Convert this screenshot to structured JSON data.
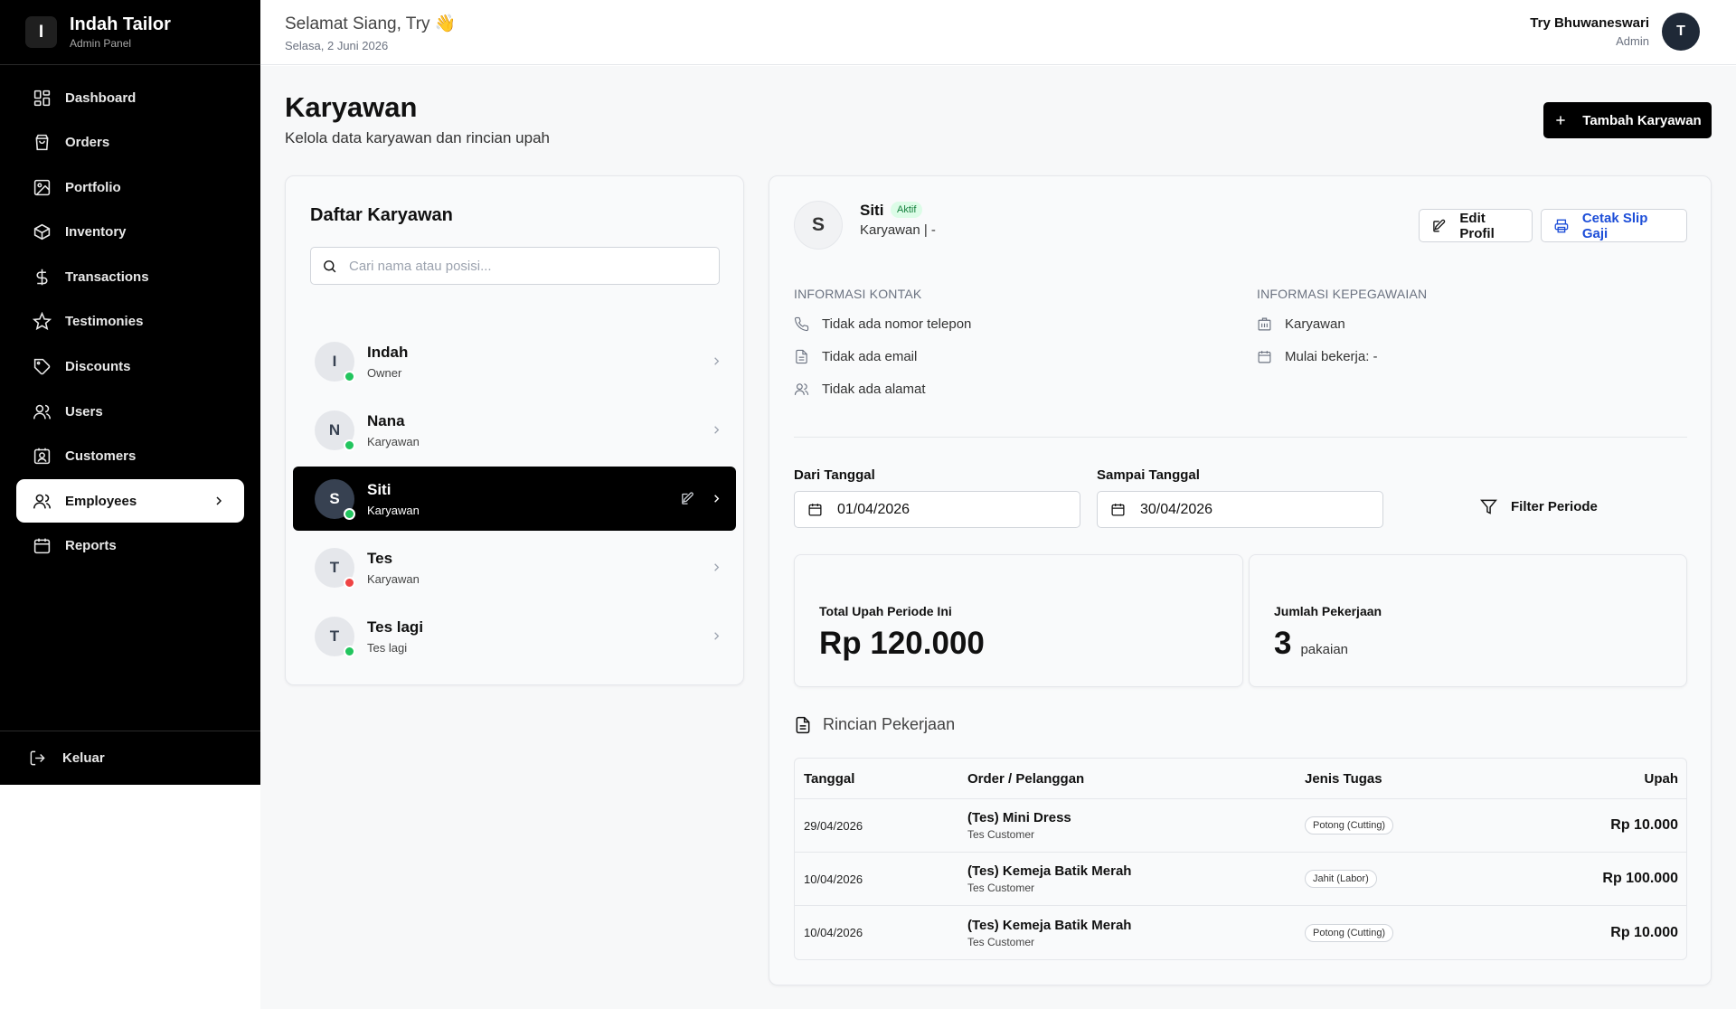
{
  "brand": {
    "initial": "I",
    "name": "Indah Tailor",
    "sub": "Admin Panel"
  },
  "nav": {
    "items": [
      {
        "label": "Dashboard",
        "icon": "dashboard-icon"
      },
      {
        "label": "Orders",
        "icon": "shopping-bag-icon"
      },
      {
        "label": "Portfolio",
        "icon": "image-icon"
      },
      {
        "label": "Inventory",
        "icon": "box-icon"
      },
      {
        "label": "Transactions",
        "icon": "dollar-icon"
      },
      {
        "label": "Testimonies",
        "icon": "star-icon"
      },
      {
        "label": "Discounts",
        "icon": "tag-icon"
      },
      {
        "label": "Users",
        "icon": "users-icon"
      },
      {
        "label": "Customers",
        "icon": "contact-icon"
      },
      {
        "label": "Employees",
        "icon": "users-icon"
      },
      {
        "label": "Reports",
        "icon": "calendar-icon"
      }
    ],
    "active": "Employees",
    "logout": "Keluar"
  },
  "topbar": {
    "greeting": "Selamat Siang, Try 👋",
    "date": "Selasa, 2 Juni 2026",
    "user_name": "Try Bhuwaneswari",
    "user_role": "Admin",
    "user_initial": "T"
  },
  "page": {
    "title": "Karyawan",
    "subtitle": "Kelola data karyawan dan rincian upah",
    "add_button": "Tambah Karyawan"
  },
  "list": {
    "title": "Daftar Karyawan",
    "search_placeholder": "Cari nama atau posisi...",
    "employees": [
      {
        "initial": "I",
        "name": "Indah",
        "role": "Owner",
        "status": "active"
      },
      {
        "initial": "N",
        "name": "Nana",
        "role": "Karyawan",
        "status": "active"
      },
      {
        "initial": "S",
        "name": "Siti",
        "role": "Karyawan",
        "status": "active"
      },
      {
        "initial": "T",
        "name": "Tes",
        "role": "Karyawan",
        "status": "inactive"
      },
      {
        "initial": "T",
        "name": "Tes lagi",
        "role": "Tes lagi",
        "status": "active"
      }
    ],
    "selected": "Siti"
  },
  "detail": {
    "initial": "S",
    "name": "Siti",
    "badge": "Aktif",
    "role_line": "Karyawan | -",
    "edit_button": "Edit Profil",
    "print_button": "Cetak Slip Gaji",
    "contact_label": "INFORMASI KONTAK",
    "contact": {
      "phone": "Tidak ada nomor telepon",
      "email": "Tidak ada email",
      "address": "Tidak ada alamat"
    },
    "employment_label": "INFORMASI KEPEGAWAIAN",
    "employment": {
      "position": "Karyawan",
      "start": "Mulai bekerja: -"
    },
    "filter": {
      "from_label": "Dari Tanggal",
      "from_value": "01/04/2026",
      "to_label": "Sampai Tanggal",
      "to_value": "30/04/2026",
      "button": "Filter Periode"
    },
    "stats": {
      "wage_label": "Total Upah Periode Ini",
      "wage_value": "Rp 120.000",
      "jobs_label": "Jumlah Pekerjaan",
      "jobs_value": "3",
      "jobs_unit": "pakaian"
    },
    "work_title": "Rincian Pekerjaan",
    "table": {
      "headers": [
        "Tanggal",
        "Order / Pelanggan",
        "Jenis Tugas",
        "Upah"
      ],
      "rows": [
        {
          "date": "29/04/2026",
          "order": "(Tes) Mini Dress",
          "customer": "Tes Customer",
          "task": "Potong (Cutting)",
          "wage": "Rp 10.000"
        },
        {
          "date": "10/04/2026",
          "order": "(Tes) Kemeja Batik Merah",
          "customer": "Tes Customer",
          "task": "Jahit (Labor)",
          "wage": "Rp 100.000"
        },
        {
          "date": "10/04/2026",
          "order": "(Tes) Kemeja Batik Merah",
          "customer": "Tes Customer",
          "task": "Potong (Cutting)",
          "wage": "Rp 10.000"
        }
      ]
    }
  }
}
